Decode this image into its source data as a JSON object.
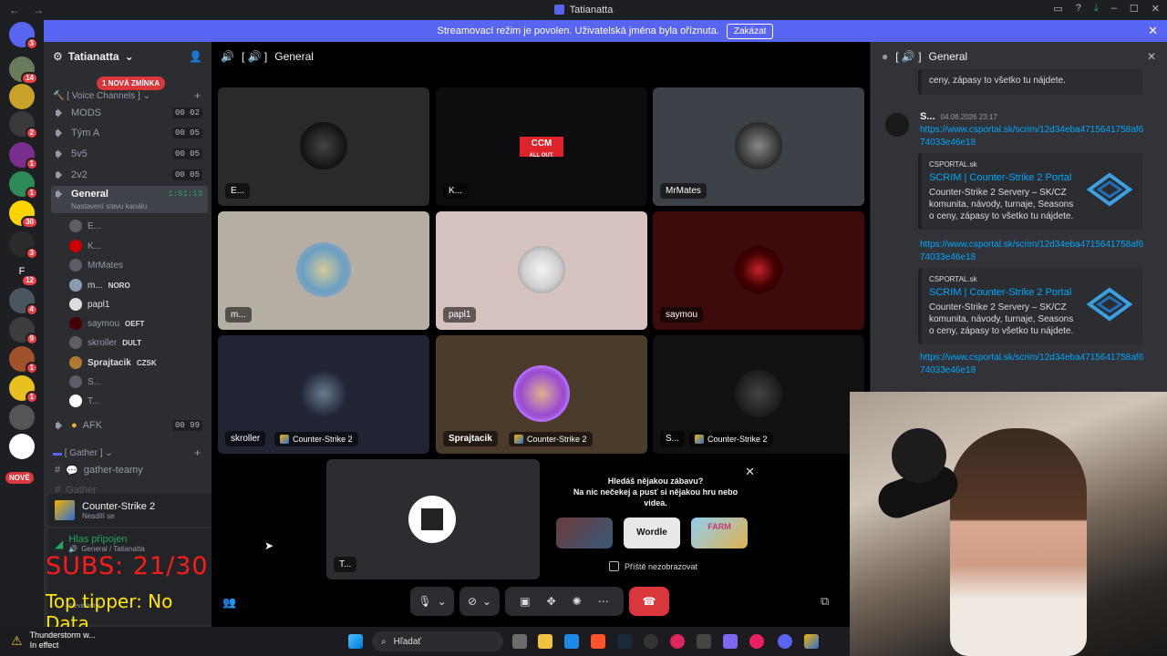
{
  "window": {
    "title": "Tatianatta"
  },
  "banner": {
    "text": "Streamovací režim je povolen. Uživatelská jména byla oříznuta.",
    "button": "Zakázat"
  },
  "rail": {
    "badges": [
      "3",
      "14",
      "2",
      "1",
      "1",
      "1",
      "30",
      "3",
      "12",
      "4",
      "1",
      "9",
      "1",
      "1"
    ],
    "new_label": "NOVÉ"
  },
  "sidebar": {
    "server_name": "Tatianatta",
    "mention_pill": "1 NOVÁ ZMÍNKA",
    "voice_category": "[ Voice Channels ]",
    "gather_category": "[ Gather ]",
    "channels": [
      {
        "name": "MODS",
        "count": "00 02"
      },
      {
        "name": "Tým A",
        "count": "00 05"
      },
      {
        "name": "5v5",
        "count": "00 05"
      },
      {
        "name": "2v2",
        "count": "00 05"
      }
    ],
    "general": {
      "name": "General",
      "timer": "1:51:13",
      "status_hint": "Nastavení stavu kanálu"
    },
    "members": [
      {
        "name": "E...",
        "tag": ""
      },
      {
        "name": "K...",
        "tag": ""
      },
      {
        "name": "MrMates",
        "tag": ""
      },
      {
        "name": "m...",
        "tag": "NORO"
      },
      {
        "name": "papl1",
        "tag": ""
      },
      {
        "name": "saymou",
        "tag": "OEFT"
      },
      {
        "name": "skroller",
        "tag": "DULT"
      },
      {
        "name": "Sprajtacik",
        "tag": "CZSK"
      },
      {
        "name": "S...",
        "tag": ""
      },
      {
        "name": "T...",
        "tag": ""
      }
    ],
    "afk": {
      "name": "AFK",
      "count": "00 99"
    },
    "gather_channel": "gather-teamy",
    "gather_channel2": "Gather",
    "game_panel": {
      "title": "Counter-Strike 2",
      "subtitle": "Nesdílí se"
    },
    "voice_panel": {
      "status": "Hlas připojen",
      "location": "General / Tatianatta",
      "user_status": "Neviditelný"
    },
    "overlay": {
      "subs": "SUBS: 21/30",
      "tipper": "Top tipper: No Data"
    }
  },
  "main": {
    "channel": "General",
    "tiles": [
      {
        "name": "E...",
        "game": ""
      },
      {
        "name": "K...",
        "game": ""
      },
      {
        "name": "MrMates",
        "game": ""
      },
      {
        "name": "m...",
        "game": ""
      },
      {
        "name": "papl1",
        "game": ""
      },
      {
        "name": "saymou",
        "game": ""
      },
      {
        "name": "skroller",
        "game": "Counter-Strike 2"
      },
      {
        "name": "Sprajtacik",
        "game": "Counter-Strike 2"
      },
      {
        "name": "S...",
        "game": "Counter-Strike 2"
      }
    ],
    "self_tile": {
      "name": "T..."
    },
    "ccm_logo": {
      "line1": "CCM",
      "line2": "ALL OUT."
    },
    "activity": {
      "heading": "Hledáš nějakou zábavu?",
      "body": "Na nic nečekej a pusť si nějakou hru nebo videa.",
      "games": [
        "",
        "Wordle",
        "FARM"
      ],
      "checkbox_label": "Příště nezobrazovat"
    }
  },
  "chat": {
    "channel": "General",
    "top_snippet": "ceny, zápasy to všetko tu nájdete.",
    "message": {
      "author": "S...",
      "time": "04.08.2026 23:17",
      "link": "https://www.csportal.sk/scrim/12d34eba4715641758af674033e46e18"
    },
    "embed": {
      "provider": "CSPORTAL.sk",
      "title": "SCRIM | Counter-Strike 2 Portal",
      "description": "Counter-Strike 2 Servery – SK/CZ komunita, návody, turnaje, Seasons o ceny, zápasy to všetko tu nájdete."
    }
  },
  "taskbar": {
    "weather_title": "Thunderstorm w...",
    "weather_sub": "In effect",
    "search_placeholder": "Hľadať"
  },
  "colors": {
    "blurple": "#5865f2",
    "red": "#da373c",
    "link": "#00a8fc",
    "green": "#23a55a"
  }
}
